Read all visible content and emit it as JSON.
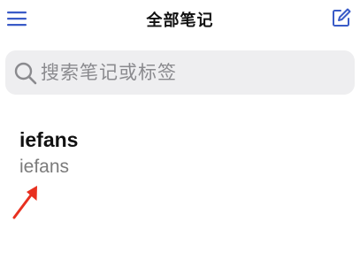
{
  "header": {
    "title": "全部笔记",
    "menu_icon": "menu-icon",
    "compose_icon": "compose-icon"
  },
  "search": {
    "placeholder": "搜索笔记或标签",
    "value": "",
    "icon": "search-icon"
  },
  "notes": [
    {
      "title": "iefans",
      "preview": "iefans"
    }
  ],
  "colors": {
    "accent": "#3a5bc7",
    "search_bg": "#eeeef0",
    "annotation": "#e8301f"
  }
}
